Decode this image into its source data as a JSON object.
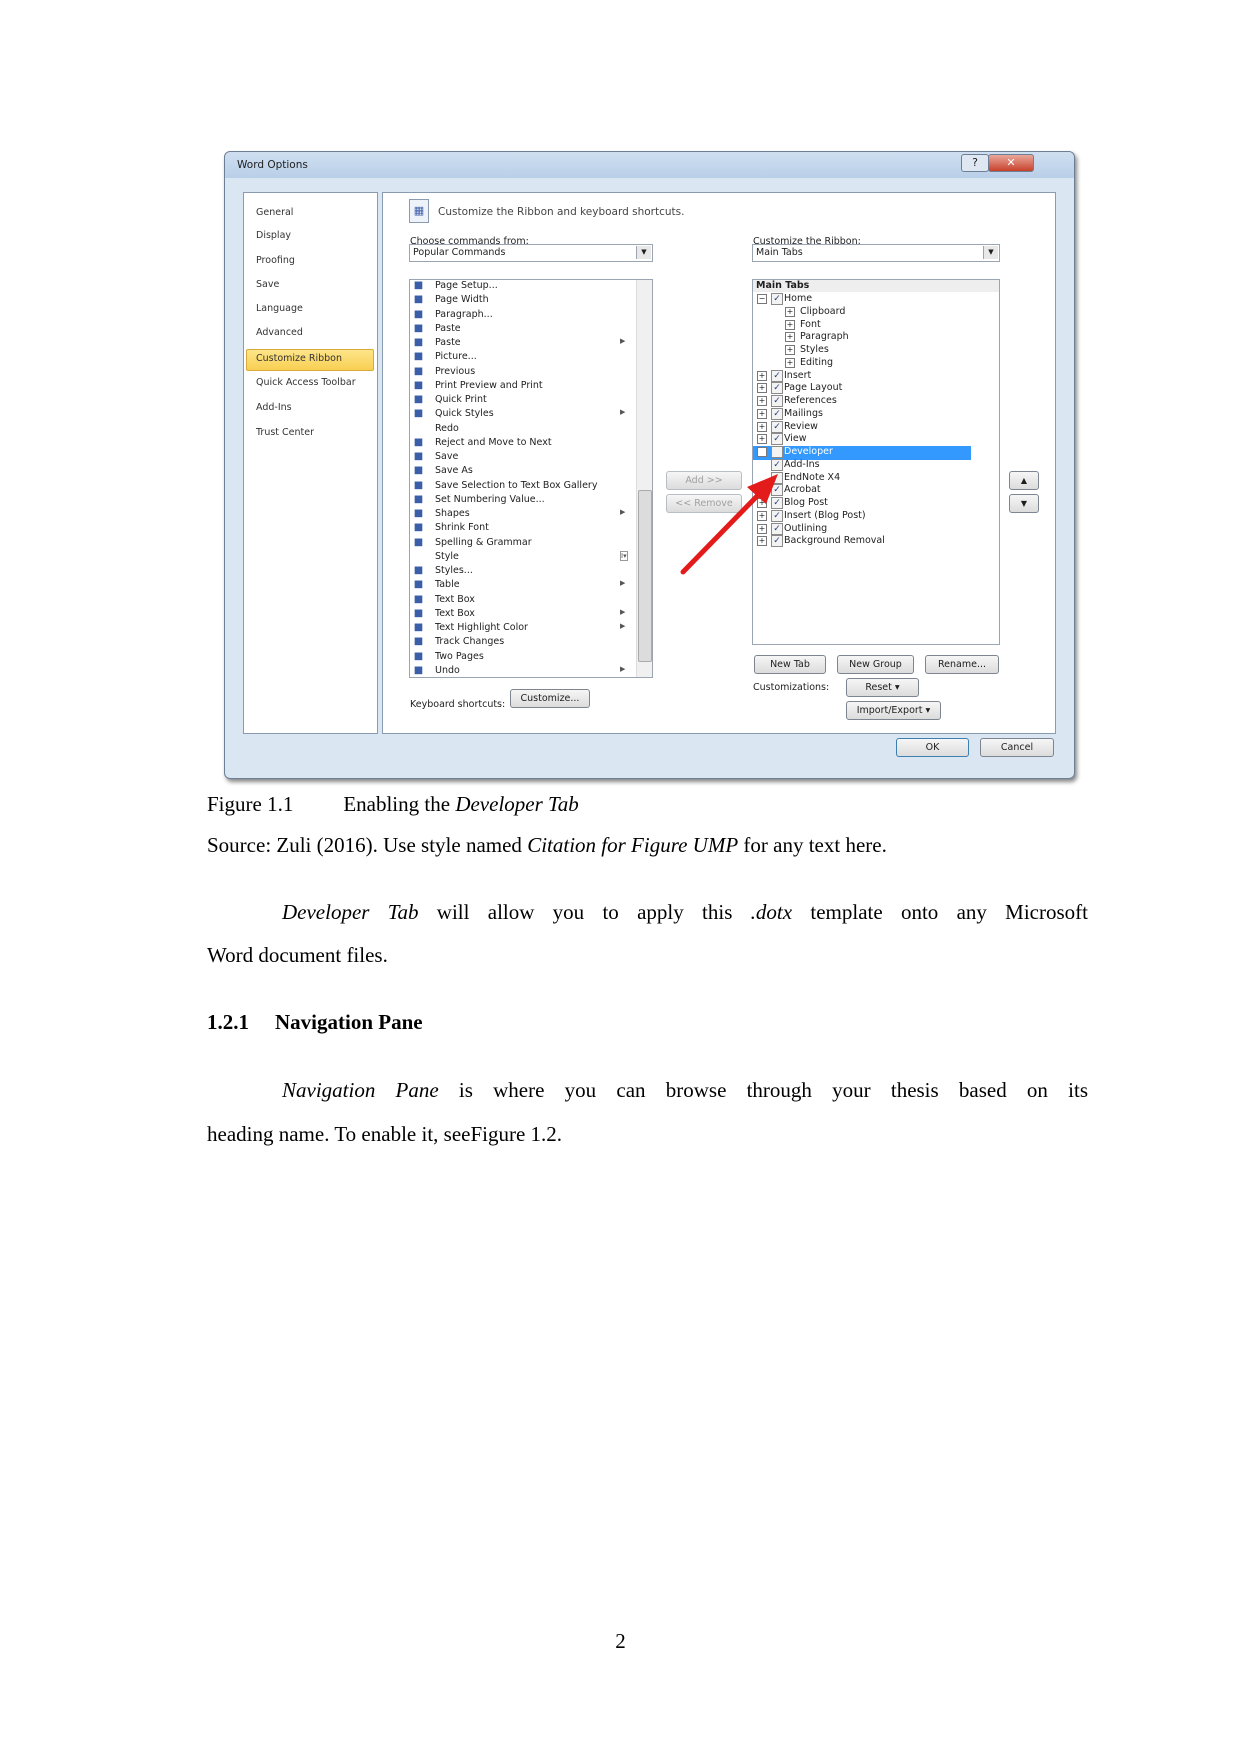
{
  "dialog": {
    "title": "Word Options",
    "help_button": "?",
    "close_button": "✕",
    "nav": [
      "General",
      "Display",
      "Proofing",
      "Save",
      "Language",
      "Advanced",
      "Customize Ribbon",
      "Quick Access Toolbar",
      "Add-Ins",
      "Trust Center"
    ],
    "nav_selected": "Customize Ribbon",
    "header": "Customize the Ribbon and keyboard shortcuts.",
    "choose_label": "Choose commands from:",
    "choose_value": "Popular Commands",
    "commands": [
      {
        "label": "Page Setup...",
        "icon": "page-setup"
      },
      {
        "label": "Page Width",
        "icon": "page-width"
      },
      {
        "label": "Paragraph...",
        "icon": "paragraph"
      },
      {
        "label": "Paste",
        "icon": "paste"
      },
      {
        "label": "Paste",
        "icon": "paste",
        "submenu": true
      },
      {
        "label": "Picture...",
        "icon": "picture"
      },
      {
        "label": "Previous",
        "icon": "previous"
      },
      {
        "label": "Print Preview and Print",
        "icon": "print-preview"
      },
      {
        "label": "Quick Print",
        "icon": "print"
      },
      {
        "label": "Quick Styles",
        "icon": "quick-styles",
        "submenu": true
      },
      {
        "label": "Redo",
        "icon": ""
      },
      {
        "label": "Reject and Move to Next",
        "icon": "reject"
      },
      {
        "label": "Save",
        "icon": "save"
      },
      {
        "label": "Save As",
        "icon": "save-as"
      },
      {
        "label": "Save Selection to Text Box Gallery",
        "icon": "save-selection"
      },
      {
        "label": "Set Numbering Value...",
        "icon": "numbering"
      },
      {
        "label": "Shapes",
        "icon": "shapes",
        "submenu": true
      },
      {
        "label": "Shrink Font",
        "icon": "shrink-font"
      },
      {
        "label": "Spelling & Grammar",
        "icon": "spelling"
      },
      {
        "label": "Style",
        "icon": "",
        "combo": true
      },
      {
        "label": "Styles...",
        "icon": "styles"
      },
      {
        "label": "Table",
        "icon": "table",
        "submenu": true
      },
      {
        "label": "Text Box",
        "icon": "text-box"
      },
      {
        "label": "Text Box",
        "icon": "text-box",
        "submenu": true
      },
      {
        "label": "Text Highlight Color",
        "icon": "highlight",
        "submenu": true
      },
      {
        "label": "Track Changes",
        "icon": "track-changes"
      },
      {
        "label": "Two Pages",
        "icon": "two-pages"
      },
      {
        "label": "Undo",
        "icon": "undo",
        "submenu": true
      }
    ],
    "add_button": "Add >>",
    "remove_button": "<< Remove",
    "keyboard_label": "Keyboard shortcuts:",
    "customize_button": "Customize...",
    "ribbon_label": "Customize the Ribbon:",
    "ribbon_value": "Main Tabs",
    "tree_header": "Main Tabs",
    "tree": [
      {
        "label": "Home",
        "level": 0,
        "expander": "−",
        "checked": true
      },
      {
        "label": "Clipboard",
        "level": 1,
        "expander": "+"
      },
      {
        "label": "Font",
        "level": 1,
        "expander": "+"
      },
      {
        "label": "Paragraph",
        "level": 1,
        "expander": "+"
      },
      {
        "label": "Styles",
        "level": 1,
        "expander": "+"
      },
      {
        "label": "Editing",
        "level": 1,
        "expander": "+"
      },
      {
        "label": "Insert",
        "level": 0,
        "expander": "+",
        "checked": true
      },
      {
        "label": "Page Layout",
        "level": 0,
        "expander": "+",
        "checked": true
      },
      {
        "label": "References",
        "level": 0,
        "expander": "+",
        "checked": true
      },
      {
        "label": "Mailings",
        "level": 0,
        "expander": "+",
        "checked": true
      },
      {
        "label": "Review",
        "level": 0,
        "expander": "+",
        "checked": true
      },
      {
        "label": "View",
        "level": 0,
        "expander": "+",
        "checked": true
      },
      {
        "label": "Developer",
        "level": 0,
        "expander": "+",
        "checked": false,
        "selected": true
      },
      {
        "label": "Add-Ins",
        "level": 0,
        "checked": true
      },
      {
        "label": "EndNote X4",
        "level": 0,
        "checked": false
      },
      {
        "label": "Acrobat",
        "level": 0,
        "expander": "+",
        "checked": true
      },
      {
        "label": "Blog Post",
        "level": 0,
        "expander": "+",
        "checked": true
      },
      {
        "label": "Insert (Blog Post)",
        "level": 0,
        "expander": "+",
        "checked": true
      },
      {
        "label": "Outlining",
        "level": 0,
        "expander": "+",
        "checked": true
      },
      {
        "label": "Background Removal",
        "level": 0,
        "expander": "+",
        "checked": true
      }
    ],
    "new_tab": "New Tab",
    "new_group": "New Group",
    "rename": "Rename...",
    "customizations_label": "Customizations:",
    "reset": "Reset ▾",
    "import_export": "Import/Export ▾",
    "ok": "OK",
    "cancel": "Cancel",
    "colors": {
      "selection": "#3399ff",
      "nav_selected": "#f8cf52",
      "arrow": "#e31b1b"
    }
  },
  "caption": {
    "number": "Figure 1.1",
    "title_pre": "Enabling the ",
    "title_em": "Developer Tab"
  },
  "source": {
    "pre": "Source: Zuli (2016). Use style named ",
    "em": "Citation for Figure UMP",
    "post": " for any text here."
  },
  "para1": {
    "em1": "Developer Tab",
    "t1": " will allow you to apply this ",
    "em2": ".dotx",
    "t2": " template onto any Microsoft",
    "line2": "Word document files."
  },
  "heading": {
    "number": "1.2.1",
    "text": "Navigation Pane"
  },
  "para2": {
    "em1": "Navigation Pane",
    "t1": " is where you can browse through your thesis based on its",
    "line2": "heading name. To enable it, seeFigure 1.2."
  },
  "page_number": "2"
}
